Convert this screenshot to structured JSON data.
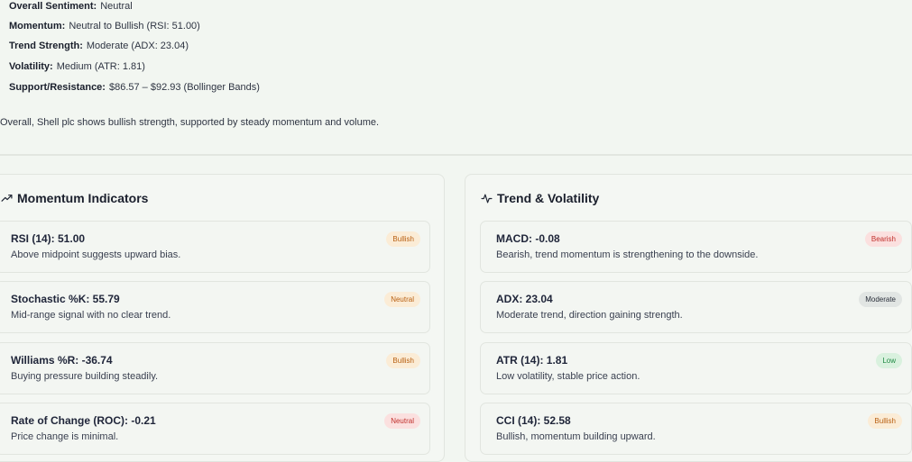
{
  "summary": {
    "lines": [
      {
        "label": "Overall Sentiment:",
        "value": "Neutral"
      },
      {
        "label": "Momentum:",
        "value": "Neutral to Bullish (RSI: 51.00)"
      },
      {
        "label": "Trend Strength:",
        "value": "Moderate (ADX: 23.04)"
      },
      {
        "label": "Volatility:",
        "value": "Medium (ATR: 1.81)"
      },
      {
        "label": "Support/Resistance:",
        "value": "$86.57 – $92.93 (Bollinger Bands)"
      }
    ],
    "conclusion": "Overall, Shell plc shows bullish strength, supported by steady momentum and volume."
  },
  "momentum_panel": {
    "title": "Momentum Indicators",
    "icon": "trending-up-icon",
    "cards": [
      {
        "title": "RSI (14): 51.00",
        "description": "Above midpoint suggests upward bias.",
        "badge": "Bullish",
        "badge_style": "bullish"
      },
      {
        "title": "Stochastic %K: 55.79",
        "description": "Mid-range signal with no clear trend.",
        "badge": "Neutral",
        "badge_style": "neutral-orange"
      },
      {
        "title": "Williams %R: -36.74",
        "description": "Buying pressure building steadily.",
        "badge": "Bullish",
        "badge_style": "bullish"
      },
      {
        "title": "Rate of Change (ROC): -0.21",
        "description": "Price change is minimal.",
        "badge": "Neutral",
        "badge_style": "neutral-red"
      }
    ]
  },
  "trend_panel": {
    "title": "Trend & Volatility",
    "icon": "activity-pulse-icon",
    "cards": [
      {
        "title": "MACD: -0.08",
        "description": "Bearish, trend momentum is strengthening to the downside.",
        "badge": "Bearish",
        "badge_style": "bearish"
      },
      {
        "title": "ADX: 23.04",
        "description": "Moderate trend, direction gaining strength.",
        "badge": "Moderate",
        "badge_style": "moderate"
      },
      {
        "title": "ATR (14): 1.81",
        "description": "Low volatility, stable price action.",
        "badge": "Low",
        "badge_style": "low"
      },
      {
        "title": "CCI (14): 52.58",
        "description": "Bullish, momentum building upward.",
        "badge": "Bullish",
        "badge_style": "bullish"
      }
    ]
  },
  "badge_colors": {
    "bullish": {
      "bg": "#fbecd6",
      "fg": "#b85f10"
    },
    "neutral-orange": {
      "bg": "#fbecd6",
      "fg": "#b85f10"
    },
    "neutral-red": {
      "bg": "#fbe0df",
      "fg": "#c0302c"
    },
    "bearish": {
      "bg": "#fbe0df",
      "fg": "#c0302c"
    },
    "moderate": {
      "bg": "#e1e5e3",
      "fg": "#2a2f3a"
    },
    "low": {
      "bg": "#d9f1de",
      "fg": "#1f8a43"
    }
  }
}
